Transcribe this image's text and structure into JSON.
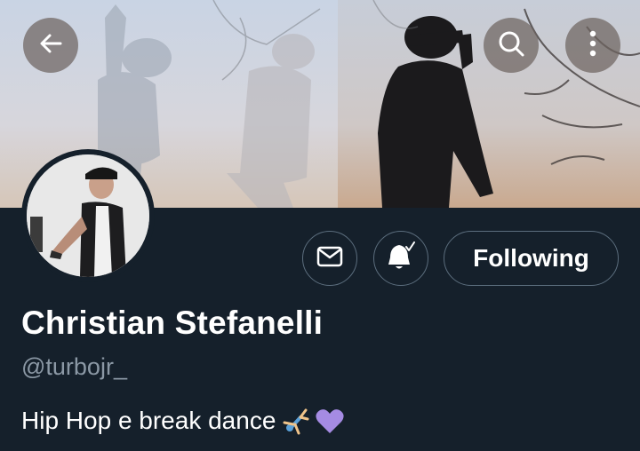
{
  "header": {
    "back_icon": "arrow-left-icon",
    "search_icon": "search-icon",
    "more_icon": "more-vertical-icon"
  },
  "actions": {
    "message_icon": "envelope-icon",
    "notify_icon": "bell-check-icon",
    "follow_label": "Following"
  },
  "profile": {
    "name": "Christian Stefanelli",
    "handle": "@turbojr_",
    "bio_text": "Hip Hop e break dance",
    "bio_emojis": [
      "cartwheel-icon",
      "purple-heart-icon"
    ]
  },
  "colors": {
    "background": "#15202b",
    "secondary_text": "#8b98a5",
    "border": "#5c6e7e",
    "heart": "#a58be3"
  }
}
